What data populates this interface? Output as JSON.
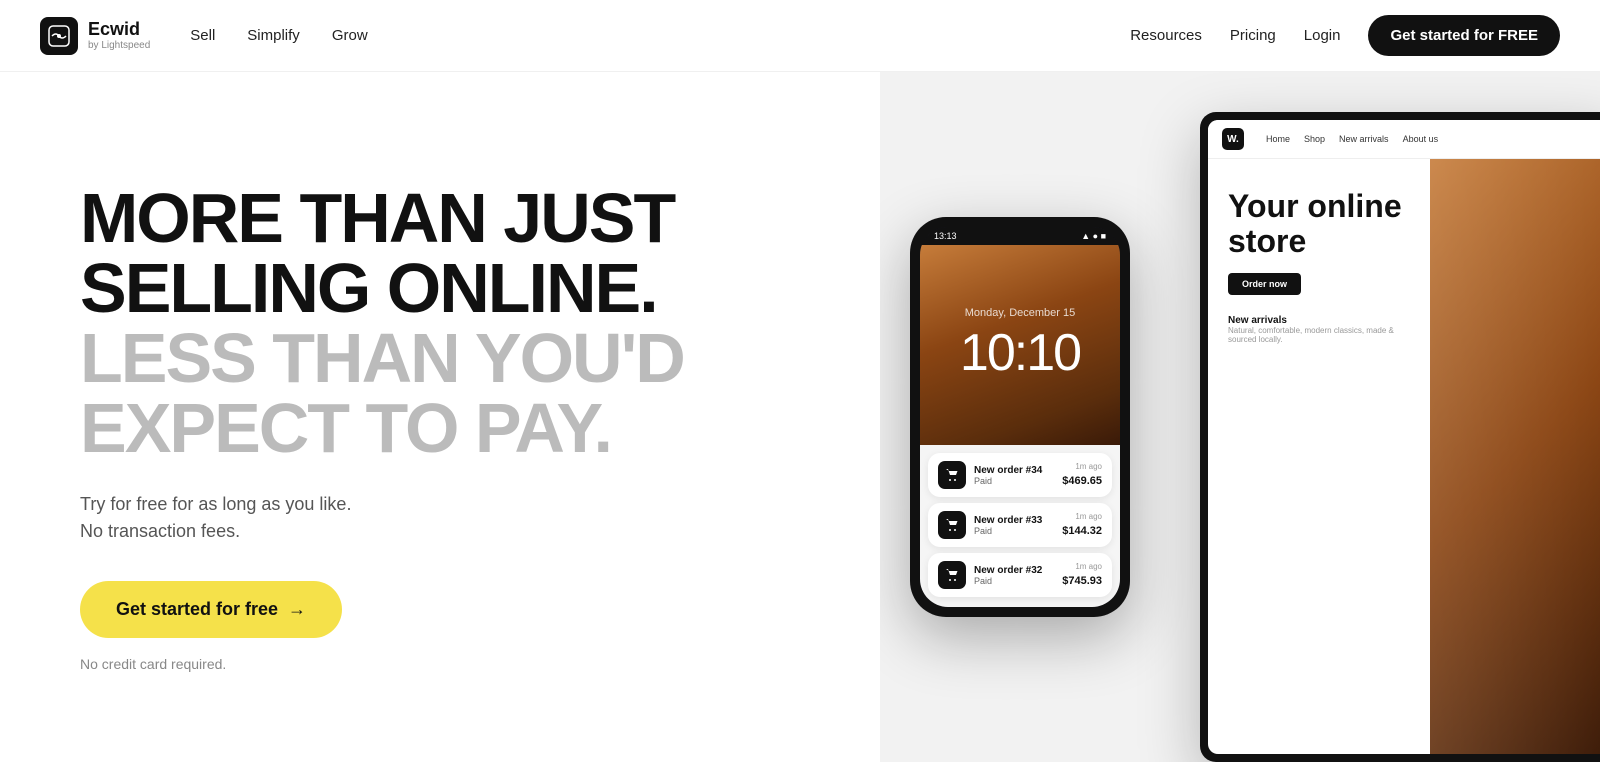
{
  "nav": {
    "logo": {
      "brand": "Ecwid",
      "sub": "by Lightspeed"
    },
    "left_links": [
      {
        "label": "Sell",
        "href": "#"
      },
      {
        "label": "Simplify",
        "href": "#"
      },
      {
        "label": "Grow",
        "href": "#"
      }
    ],
    "right_links": [
      {
        "label": "Resources",
        "href": "#"
      },
      {
        "label": "Pricing",
        "href": "#"
      },
      {
        "label": "Login",
        "href": "#"
      }
    ],
    "cta": "Get started for FREE"
  },
  "hero": {
    "heading_line1": "MORE THAN JUST",
    "heading_line2": "SELLING ONLINE.",
    "heading_line3": "LESS THAN YOU'D",
    "heading_line4": "EXPECT TO PAY.",
    "subtext_line1": "Try for free for as long as you like.",
    "subtext_line2": "No transaction fees.",
    "cta_label": "Get started for free",
    "cta_arrow": "→",
    "no_cc": "No credit card required."
  },
  "phone": {
    "time_label": "13:13",
    "date_label": "Monday, December 15",
    "time_display": "10:10",
    "notifications": [
      {
        "title": "New order #34",
        "status": "Paid",
        "time": "1m ago",
        "amount": "$469.65",
        "highlighted": true
      },
      {
        "title": "New order #33",
        "status": "Paid",
        "time": "1m ago",
        "amount": "$144.32",
        "highlighted": false
      },
      {
        "title": "New order #32",
        "status": "Paid",
        "time": "1m ago",
        "amount": "$745.93",
        "highlighted": false
      }
    ]
  },
  "tablet": {
    "nav_logo": "W.",
    "nav_links": [
      "Home",
      "Shop",
      "New arrivals",
      "About us"
    ],
    "hero_title": "Your online store",
    "cta_btn": "Order now",
    "new_arrivals_label": "New arrivals",
    "new_arrivals_sub": "Natural, comfortable, modern classics, made & sourced locally."
  }
}
